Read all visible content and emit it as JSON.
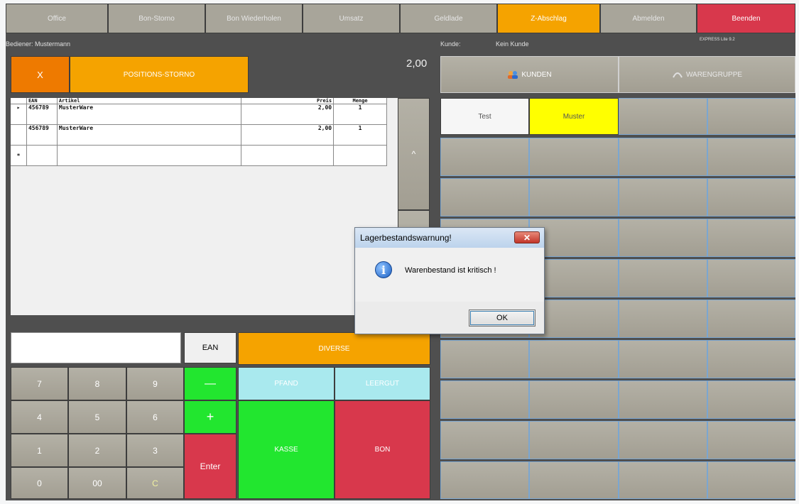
{
  "topbar": {
    "office": "Office",
    "bon_storno": "Bon-Storno",
    "bon_wiederholen": "Bon Wiederholen",
    "umsatz": "Umsatz",
    "geldlade": "Geldlade",
    "z_abschlag": "Z-Abschlag",
    "abmelden": "Abmelden",
    "beenden": "Beenden"
  },
  "info": {
    "bediener": "Bediener: Mustermann",
    "kunde_label": "Kunde:",
    "kunde_value": "Kein Kunde",
    "version": "EXPRESS Lite 9.2"
  },
  "actions": {
    "cancel": "X",
    "positions_storno": "POSITIONS-STORNO",
    "total": "2,00",
    "kunden": "KUNDEN",
    "warengruppe": "WARENGRUPPE"
  },
  "table": {
    "columns": [
      "EAN",
      "Artikel",
      "Preis",
      "Menge"
    ],
    "rows": [
      {
        "ean": "456789",
        "artikel": "MusterWare",
        "preis": "2,00",
        "menge": "1"
      },
      {
        "ean": "456789",
        "artikel": "MusterWare",
        "preis": "2,00",
        "menge": "1"
      }
    ],
    "new_row_marker": "*",
    "scroll_up": "^"
  },
  "products": [
    "Test",
    "Muster"
  ],
  "keypad": {
    "input_value": "",
    "ean": "EAN",
    "diverse": "DIVERSE",
    "minus": "—",
    "plus": "+",
    "enter": "Enter",
    "pfand": "PFAND",
    "leergut": "LEERGUT",
    "kasse": "KASSE",
    "bon": "BON",
    "digits": [
      "7",
      "8",
      "9",
      "4",
      "5",
      "6",
      "1",
      "2",
      "3",
      "0",
      "00",
      "C"
    ]
  },
  "dialog": {
    "title": "Lagerbestandswarnung!",
    "message": "Warenbestand ist kritisch !",
    "ok": "OK",
    "close": "✕"
  },
  "colors": {
    "orange": "#f5a300",
    "red": "#d8384c",
    "green": "#22e62f",
    "cyan": "#a9e9ee",
    "yellow": "#ffff00"
  }
}
